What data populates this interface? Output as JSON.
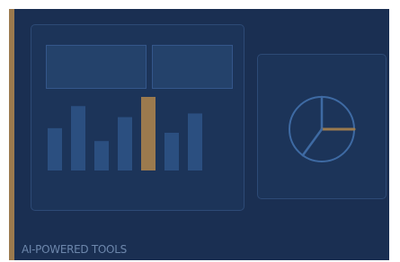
{
  "caption": "AI-POWERED TOOLS",
  "colors": {
    "background": "#1a2f52",
    "card": "#1c3459",
    "border": "#2d4a76",
    "bar": "#2b4f80",
    "highlight": "#9b7a4e",
    "pie_stroke": "#3e6aa3",
    "caption": "#6d87ac"
  },
  "chart_data": [
    {
      "type": "bar",
      "values": [
        46,
        70,
        32,
        58,
        80,
        41,
        62
      ],
      "highlight_index": 4
    },
    {
      "type": "pie",
      "values": [
        25,
        35,
        40
      ],
      "highlight_index": 0
    }
  ]
}
